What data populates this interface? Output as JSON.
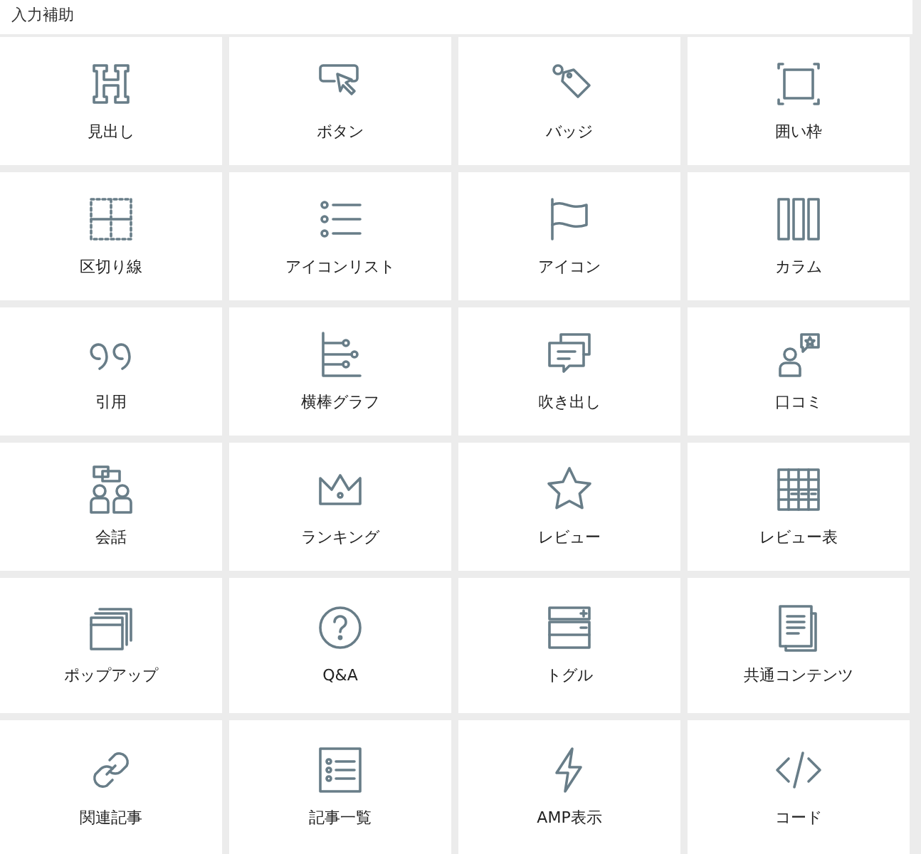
{
  "panel": {
    "title": "入力補助"
  },
  "blocks": [
    {
      "kind": "heading",
      "label": "見出し"
    },
    {
      "kind": "button",
      "label": "ボタン"
    },
    {
      "kind": "badge",
      "label": "バッジ"
    },
    {
      "kind": "frame",
      "label": "囲い枠"
    },
    {
      "kind": "divider",
      "label": "区切り線"
    },
    {
      "kind": "iconlist",
      "label": "アイコンリスト"
    },
    {
      "kind": "flag",
      "label": "アイコン"
    },
    {
      "kind": "columns",
      "label": "カラム"
    },
    {
      "kind": "quote",
      "label": "引用"
    },
    {
      "kind": "bargraph",
      "label": "横棒グラフ"
    },
    {
      "kind": "balloon",
      "label": "吹き出し"
    },
    {
      "kind": "voice",
      "label": "口コミ"
    },
    {
      "kind": "talk",
      "label": "会話"
    },
    {
      "kind": "crown",
      "label": "ランキング"
    },
    {
      "kind": "star",
      "label": "レビュー"
    },
    {
      "kind": "table",
      "label": "レビュー表"
    },
    {
      "kind": "popup",
      "label": "ポップアップ"
    },
    {
      "kind": "question",
      "label": "Q&A"
    },
    {
      "kind": "toggle",
      "label": "トグル"
    },
    {
      "kind": "documents",
      "label": "共通コンテンツ"
    },
    {
      "kind": "link",
      "label": "関連記事"
    },
    {
      "kind": "list",
      "label": "記事一覧"
    },
    {
      "kind": "bolt",
      "label": "AMP表示"
    },
    {
      "kind": "code",
      "label": "コード"
    }
  ]
}
